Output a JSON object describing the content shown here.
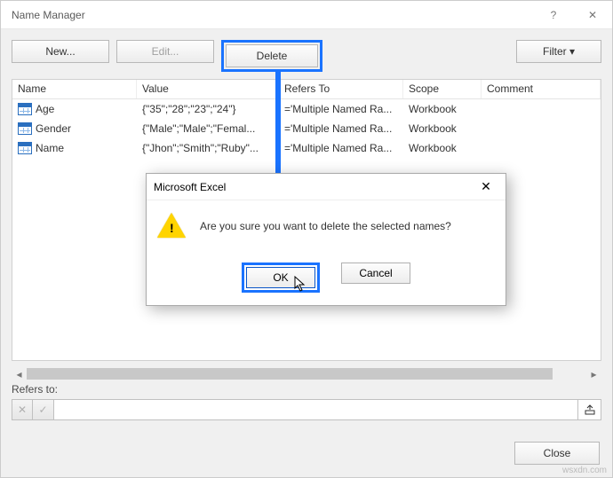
{
  "window": {
    "title": "Name Manager",
    "help_icon": "?",
    "close_icon": "✕"
  },
  "toolbar": {
    "new_label": "New...",
    "edit_label": "Edit...",
    "delete_label": "Delete",
    "filter_label": "Filter ▾"
  },
  "grid": {
    "headers": {
      "name": "Name",
      "value": "Value",
      "refers": "Refers To",
      "scope": "Scope",
      "comment": "Comment"
    },
    "rows": [
      {
        "name": "Age",
        "value": "{\"35\";\"28\";\"23\";\"24\"}",
        "refers": "='Multiple Named Ra...",
        "scope": "Workbook",
        "comment": ""
      },
      {
        "name": "Gender",
        "value": "{\"Male\";\"Male\";\"Femal...",
        "refers": "='Multiple Named Ra...",
        "scope": "Workbook",
        "comment": ""
      },
      {
        "name": "Name",
        "value": "{\"Jhon\";\"Smith\";\"Ruby\"...",
        "refers": "='Multiple Named Ra...",
        "scope": "Workbook",
        "comment": ""
      }
    ]
  },
  "refers": {
    "label": "Refers to:",
    "value": ""
  },
  "footer": {
    "close_label": "Close"
  },
  "dialog": {
    "title": "Microsoft Excel",
    "message": "Are you sure you want to delete the selected names?",
    "ok_label": "OK",
    "cancel_label": "Cancel"
  },
  "watermark": "wsxdn.com"
}
